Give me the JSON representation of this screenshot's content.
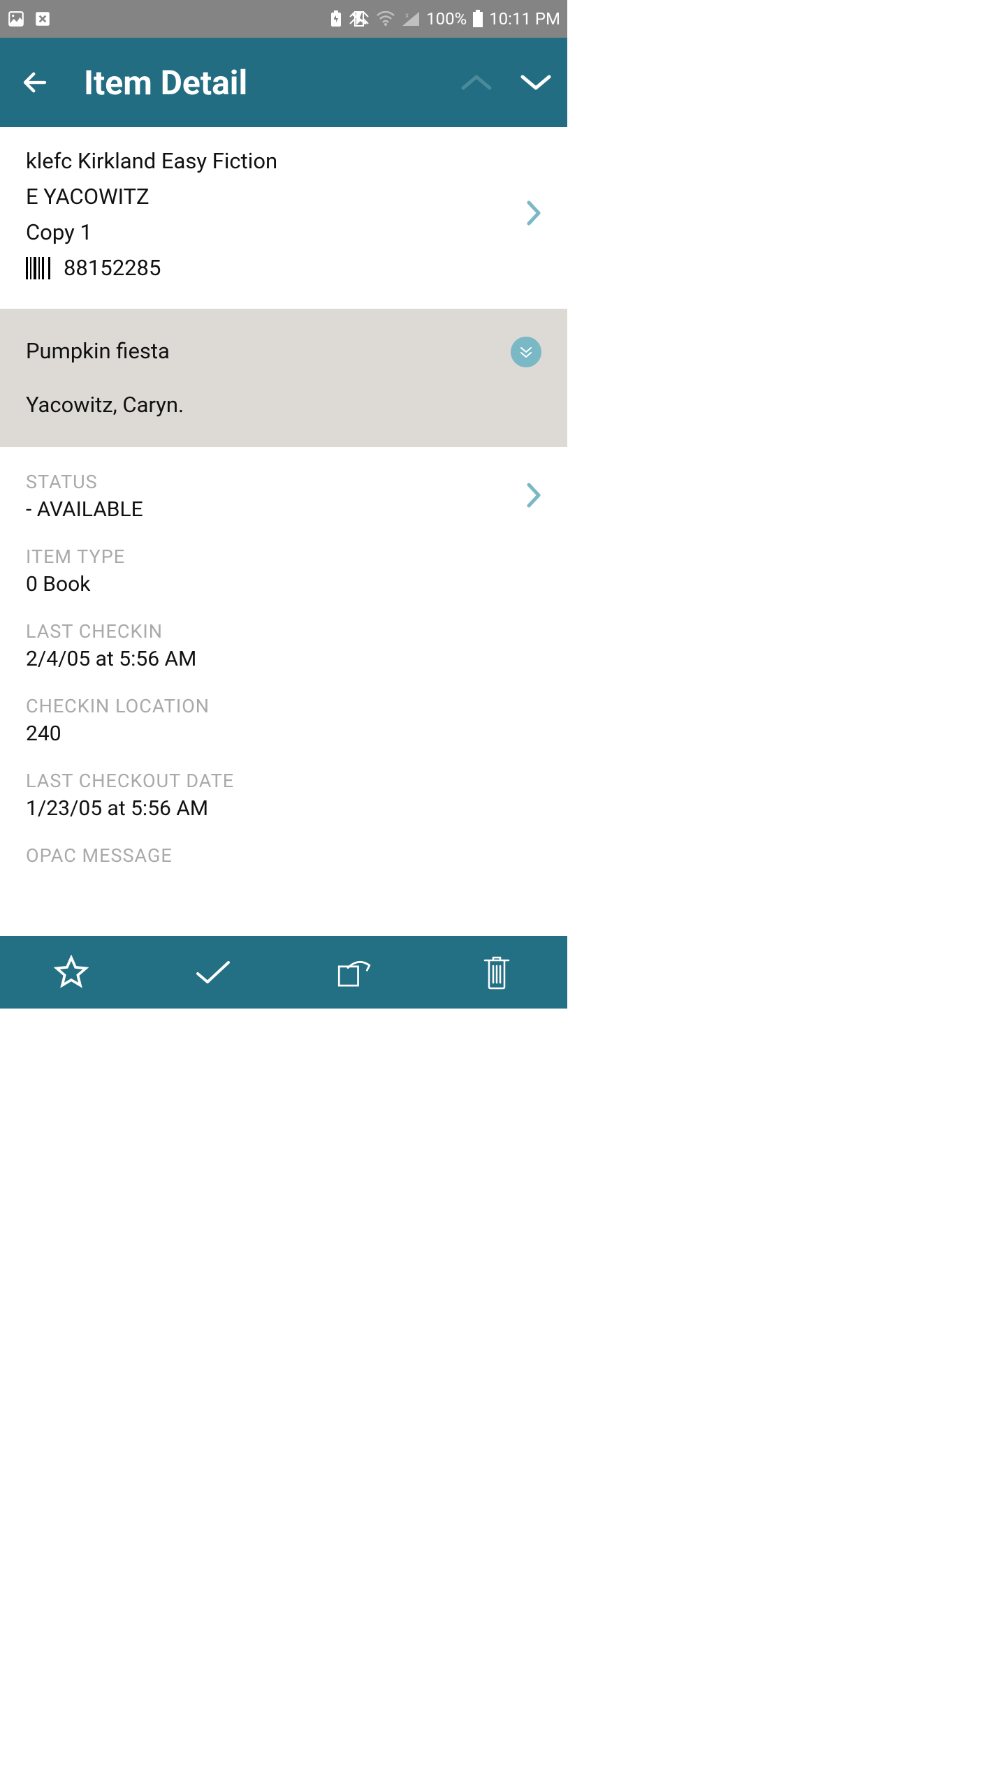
{
  "statusBar": {
    "battery": "100%",
    "time": "10:11 PM"
  },
  "appBar": {
    "title": "Item Detail"
  },
  "item": {
    "location": "klefc Kirkland Easy Fiction",
    "callNumber": "E YACOWITZ",
    "copy": "Copy 1",
    "barcode": "88152285"
  },
  "book": {
    "title": "Pumpkin fiesta",
    "author": "Yacowitz, Caryn."
  },
  "details": {
    "statusLabel": "STATUS",
    "statusValue": "- AVAILABLE",
    "itemTypeLabel": "ITEM TYPE",
    "itemTypeValue": "0 Book",
    "lastCheckinLabel": "LAST CHECKIN",
    "lastCheckinValue": "2/4/05 at 5:56 AM",
    "checkinLocationLabel": "CHECKIN LOCATION",
    "checkinLocationValue": "240",
    "lastCheckoutLabel": "LAST CHECKOUT DATE",
    "lastCheckoutValue": "1/23/05 at 5:56 AM",
    "opacMessageLabel": "OPAC MESSAGE"
  }
}
